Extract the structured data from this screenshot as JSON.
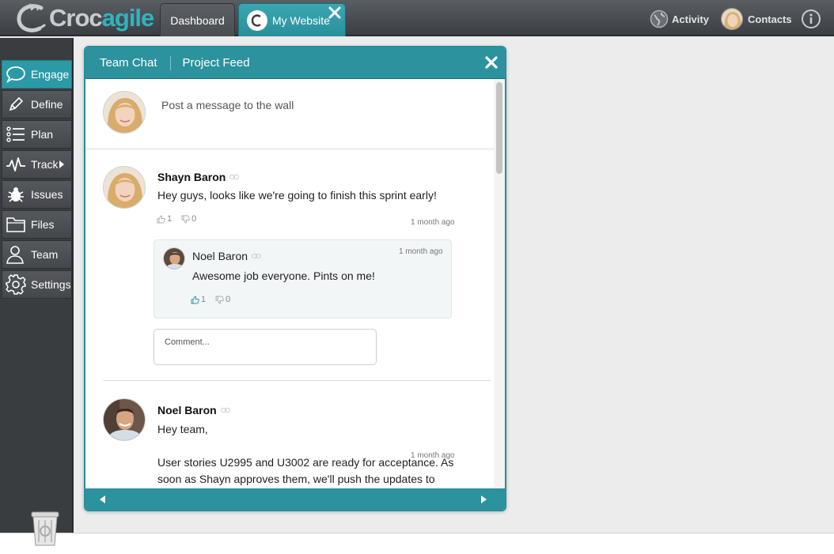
{
  "app": {
    "logo_part1": "Croc",
    "logo_part2": "agile",
    "tabs": [
      {
        "label": "Dashboard"
      },
      {
        "label": "My Website"
      }
    ],
    "activity_label": "Activity",
    "contacts_label": "Contacts"
  },
  "sidebar": {
    "items": [
      {
        "label": "Engage",
        "icon": "speech-bubble-icon",
        "active": true
      },
      {
        "label": "Define",
        "icon": "pencil-icon"
      },
      {
        "label": "Plan",
        "icon": "list-icon"
      },
      {
        "label": "Track",
        "icon": "pulse-icon"
      },
      {
        "label": "Issues",
        "icon": "bug-icon"
      },
      {
        "label": "Files",
        "icon": "folder-icon"
      },
      {
        "label": "Team",
        "icon": "person-icon"
      },
      {
        "label": "Settings",
        "icon": "gear-icon"
      }
    ]
  },
  "panel": {
    "tab_chat": "Team Chat",
    "tab_feed": "Project Feed",
    "compose_placeholder": "Post a message to the wall",
    "posts": [
      {
        "author": "Shayn Baron",
        "time": "1 month ago",
        "message": "Hey guys, looks like we're going to finish this sprint early!",
        "likes": "1",
        "dislikes": "0",
        "reply": {
          "author": "Noel Baron",
          "time": "1 month ago",
          "message": "Awesome job everyone. Pints on me!",
          "likes": "1",
          "dislikes": "0"
        },
        "comment_placeholder": "Comment..."
      },
      {
        "author": "Noel Baron",
        "time": "1 month ago",
        "message_line1": "Hey team,",
        "message_line2": "User stories U2995 and U3002 are ready for acceptance. As",
        "message_line3": "soon as Shayn approves them, we'll push the updates to"
      }
    ]
  },
  "colors": {
    "accent": "#2c929d",
    "topbar": "#4a4e53",
    "sidebar": "#3a3d40"
  }
}
